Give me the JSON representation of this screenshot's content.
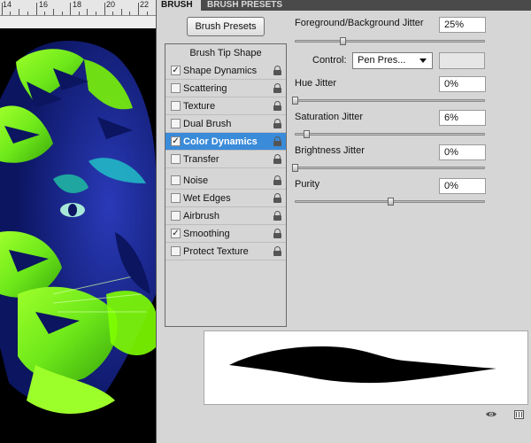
{
  "ruler": {
    "labels": [
      "14",
      "16",
      "18",
      "20",
      "22"
    ]
  },
  "tabs": {
    "brush": "BRUSH",
    "brush_presets": "BRUSH PRESETS"
  },
  "presets_button": "Brush Presets",
  "brush_options": {
    "header": "Brush Tip Shape",
    "items": [
      {
        "label": "Shape Dynamics",
        "checked": true,
        "selected": false,
        "lock_icon": "lock-icon"
      },
      {
        "label": "Scattering",
        "checked": false,
        "selected": false,
        "lock_icon": "lock-icon"
      },
      {
        "label": "Texture",
        "checked": false,
        "selected": false,
        "lock_icon": "lock-icon"
      },
      {
        "label": "Dual Brush",
        "checked": false,
        "selected": false,
        "lock_icon": "lock-icon"
      },
      {
        "label": "Color Dynamics",
        "checked": true,
        "selected": true,
        "lock_icon": "lock-icon"
      },
      {
        "label": "Transfer",
        "checked": false,
        "selected": false,
        "lock_icon": "lock-icon"
      },
      {
        "label": "Noise",
        "checked": false,
        "selected": false,
        "lock_icon": "lock-icon"
      },
      {
        "label": "Wet Edges",
        "checked": false,
        "selected": false,
        "lock_icon": "lock-icon"
      },
      {
        "label": "Airbrush",
        "checked": false,
        "selected": false,
        "lock_icon": "lock-icon"
      },
      {
        "label": "Smoothing",
        "checked": true,
        "selected": false,
        "lock_icon": "lock-icon"
      },
      {
        "label": "Protect Texture",
        "checked": false,
        "selected": false,
        "lock_icon": "lock-icon"
      }
    ]
  },
  "controls": {
    "fg_bg_jitter": {
      "label": "Foreground/Background Jitter",
      "value": "25%",
      "level": 0.25
    },
    "control": {
      "label": "Control:",
      "selected": "Pen Pres..."
    },
    "hue_jitter": {
      "label": "Hue Jitter",
      "value": "0%",
      "level": 0
    },
    "saturation_jitter": {
      "label": "Saturation Jitter",
      "value": "6%",
      "level": 0.06
    },
    "brightness_jitter": {
      "label": "Brightness Jitter",
      "value": "0%",
      "level": 0
    },
    "purity": {
      "label": "Purity",
      "value": "0%",
      "level": 0.5
    }
  },
  "colors": {
    "selection_blue": "#3a8bd9",
    "panel_gray": "#d6d6d6",
    "tiger_green": "#7fff00",
    "tiger_blue": "#1a2a9a"
  },
  "icons": {
    "visibility": "eye-icon",
    "new_preset": "grid-icon"
  }
}
